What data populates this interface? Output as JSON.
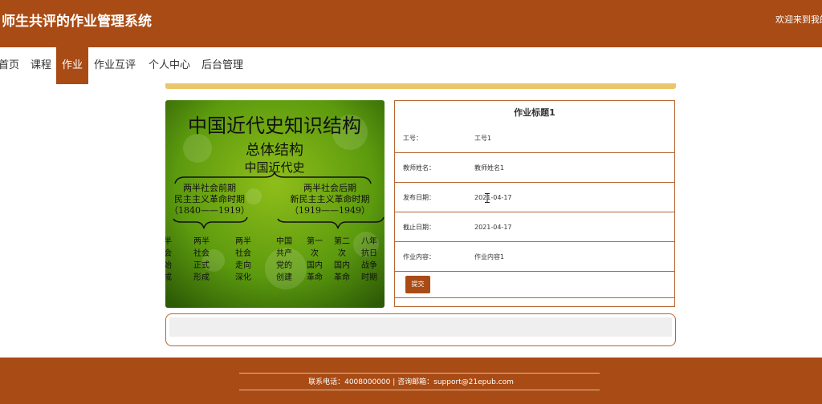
{
  "header": {
    "title": "师生共评的作业管理系统",
    "welcome": "欢迎来到我的"
  },
  "nav": {
    "items": [
      {
        "label": "首页"
      },
      {
        "label": "课程"
      },
      {
        "label": "作业",
        "active": true
      },
      {
        "label": "作业互评"
      },
      {
        "label": "个人中心"
      },
      {
        "label": "后台管理"
      }
    ]
  },
  "image": {
    "title": "中国近代史知识结构",
    "subtitle": "总体结构",
    "subtitle2": "中国近代史",
    "left_branch": {
      "l1": "两半社会前期",
      "l2": "民主主义革命时期",
      "l3": "（1840——1919）"
    },
    "right_branch": {
      "l1": "两半社会后期",
      "l2": "新民主主义革命时期",
      "l3": "（1919——1949）"
    },
    "columns_left": [
      [
        "半",
        "会",
        "始",
        "成"
      ],
      [
        "两半",
        "社会",
        "正式",
        "形成"
      ],
      [
        "两半",
        "社会",
        "走向",
        "深化"
      ]
    ],
    "columns_right": [
      [
        "中国",
        "共产",
        "党的",
        "创建"
      ],
      [
        "第一",
        "次",
        "国内",
        "革命"
      ],
      [
        "第二",
        "次",
        "国内",
        "革命"
      ],
      [
        "八年",
        "抗日",
        "战争",
        "时期"
      ]
    ]
  },
  "detail": {
    "title": "作业标题1",
    "rows": [
      {
        "label": "工号：",
        "value": "工号1"
      },
      {
        "label": "教师姓名：",
        "value": "教师姓名1"
      },
      {
        "label": "发布日期：",
        "value": "2021-04-17"
      },
      {
        "label": "截止日期：",
        "value": "2021-04-17"
      },
      {
        "label": "作业内容：",
        "value": "作业内容1"
      }
    ],
    "submit_label": "提交"
  },
  "footer": {
    "contact": "联系电话：4008000000 | 咨询邮箱：support@21epub.com"
  },
  "colors": {
    "brand": "#a94b15",
    "accent_bar": "#e9c66b"
  }
}
